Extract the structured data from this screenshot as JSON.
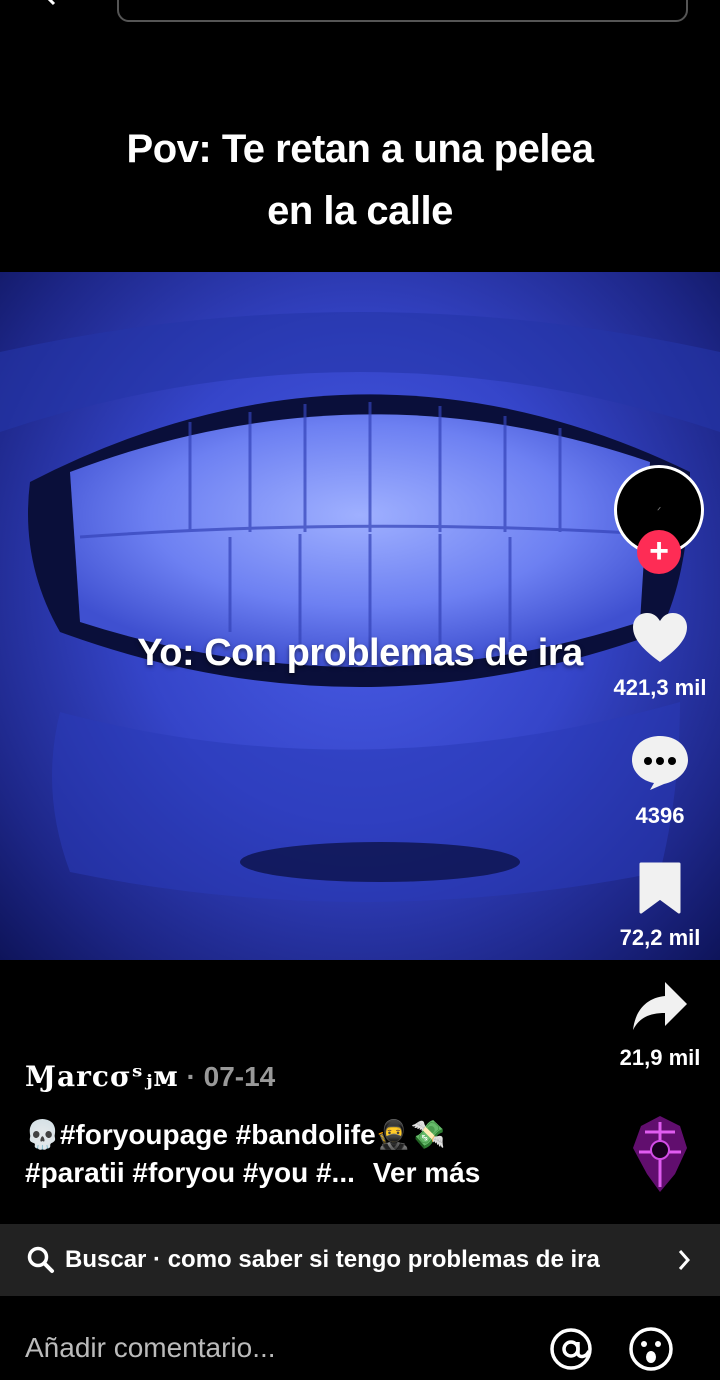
{
  "video": {
    "caption_top_line1": "Pov: Te retan a una pelea",
    "caption_top_line2": "en la calle",
    "caption_mid": "Yo: Con problemas de ira"
  },
  "actions": {
    "likes": "421,3 mil",
    "comments": "4396",
    "saves": "72,2 mil",
    "shares": "21,9 mil"
  },
  "post": {
    "author": "Ɱarcσˢⱼᴍ",
    "date": " · 07-14",
    "description_line1": "💀#foryoupage #bandolife🥷💸",
    "description_line2": "#paratii #foryou #you #...",
    "see_more": "Ver más"
  },
  "search": {
    "label": "Buscar · como saber si tengo problemas de ira"
  },
  "comment": {
    "placeholder": "Añadir comentario..."
  },
  "colors": {
    "accent": "#fe2c55",
    "video_tint": "#3545c9"
  },
  "icons": {
    "like": "heart-icon",
    "comment": "comment-icon",
    "save": "bookmark-icon",
    "share": "share-icon",
    "search": "search-icon",
    "mention": "at-icon",
    "emoji": "emoji-icon"
  }
}
